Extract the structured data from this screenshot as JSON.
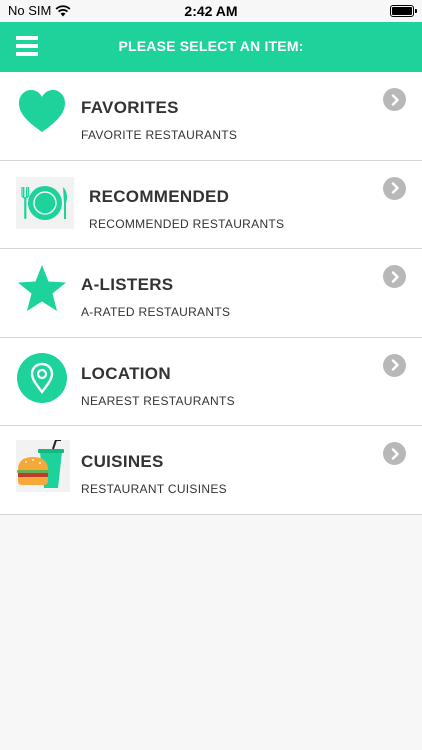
{
  "status_bar": {
    "carrier": "No SIM",
    "time": "2:42 AM"
  },
  "header": {
    "title": "PLEASE SELECT AN ITEM:",
    "accent_color": "#1dd39b"
  },
  "items": [
    {
      "title": "FAVORITES",
      "subtitle": "FAVORITE RESTAURANTS",
      "icon": "heart-icon"
    },
    {
      "title": "RECOMMENDED",
      "subtitle": "RECOMMENDED RESTAURANTS",
      "icon": "plate-cutlery-icon"
    },
    {
      "title": "A-LISTERS",
      "subtitle": "A-RATED RESTAURANTS",
      "icon": "star-icon"
    },
    {
      "title": "LOCATION",
      "subtitle": "NEAREST RESTAURANTS",
      "icon": "location-pin-icon"
    },
    {
      "title": "CUISINES",
      "subtitle": "RESTAURANT CUISINES",
      "icon": "burger-drink-icon"
    }
  ]
}
